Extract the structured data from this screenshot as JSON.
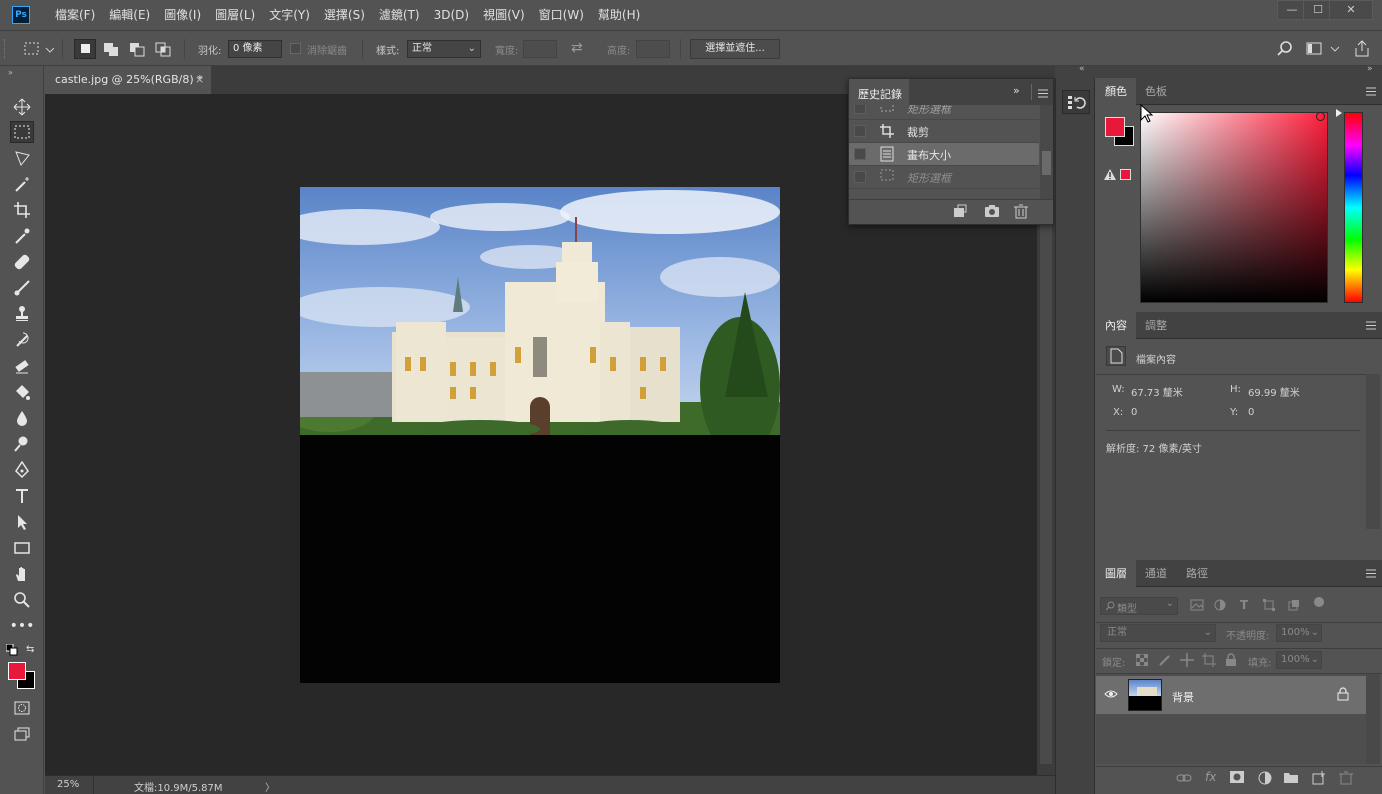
{
  "app": {
    "logo": "Ps"
  },
  "menu": [
    "檔案(F)",
    "編輯(E)",
    "圖像(I)",
    "圖層(L)",
    "文字(Y)",
    "選擇(S)",
    "濾鏡(T)",
    "3D(D)",
    "視圖(V)",
    "窗口(W)",
    "幫助(H)"
  ],
  "window_controls": {
    "minimize": "—",
    "maximize": "☐",
    "close": "✕"
  },
  "options": {
    "feather_label": "羽化:",
    "feather_value": "0 像素",
    "antialias_label": "消除鋸齒",
    "style_label": "樣式:",
    "style_value": "正常",
    "width_label": "寬度:",
    "height_label": "高度:",
    "select_mask_button": "選擇並遮住..."
  },
  "document": {
    "tab_title": "castle.jpg @ 25%(RGB/8) *",
    "tab_close": "×",
    "zoom": "25%",
    "doc_info": "文檔:10.9M/5.87M",
    "status_arrow": "〉"
  },
  "history": {
    "title": "歷史記錄",
    "items": [
      {
        "label": "矩形選框",
        "selected": false,
        "dim": true
      },
      {
        "label": "裁剪",
        "selected": false,
        "dim": false
      },
      {
        "label": "畫布大小",
        "selected": true,
        "dim": false
      },
      {
        "label": "矩形選框",
        "selected": false,
        "dim": true
      }
    ]
  },
  "color_panel": {
    "tabs": [
      "顏色",
      "色板"
    ],
    "active_tab": 0,
    "foreground": "#e8183a",
    "background": "#000000",
    "hue_base": "#ff1e3c"
  },
  "properties_panel": {
    "tabs": [
      "內容",
      "調整"
    ],
    "active_tab": 0,
    "section_title": "檔案內容",
    "w_label": "W:",
    "w_value": "67.73 釐米",
    "h_label": "H:",
    "h_value": "69.99 釐米",
    "x_label": "X:",
    "x_value": "0",
    "y_label": "Y:",
    "y_value": "0",
    "resolution": "解析度: 72 像素/英寸"
  },
  "layers_panel": {
    "tabs": [
      "圖層",
      "通道",
      "路徑"
    ],
    "active_tab": 0,
    "filter_label": "類型",
    "blend_mode": "正常",
    "opacity_label": "不透明度:",
    "opacity_value": "100%",
    "lock_label": "鎖定:",
    "fill_label": "填充:",
    "fill_value": "100%",
    "layers": [
      {
        "name": "背景",
        "visible": true,
        "locked": true
      }
    ],
    "footer_fx": "fx"
  }
}
